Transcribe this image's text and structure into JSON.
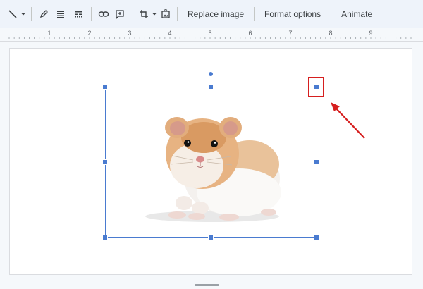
{
  "toolbar": {
    "icons": [
      "line-icon",
      "dropdown-icon",
      "pencil-icon",
      "align-icon",
      "line-weight-icon",
      "link-icon",
      "add-comment-icon",
      "crop-icon",
      "dropdown-icon",
      "reset-image-icon"
    ],
    "replace_image": "Replace image",
    "format_options": "Format options",
    "animate": "Animate"
  },
  "ruler": {
    "labels": [
      "1",
      "2",
      "3",
      "4",
      "5",
      "6",
      "7",
      "8",
      "9"
    ]
  },
  "slide": {
    "image": "hamster-photo",
    "selected": true,
    "highlighted_handle": "top-right"
  },
  "colors": {
    "selection": "#4a7bd0",
    "annotation": "#d61f1f",
    "toolbar_bg": "#eef3fa"
  }
}
